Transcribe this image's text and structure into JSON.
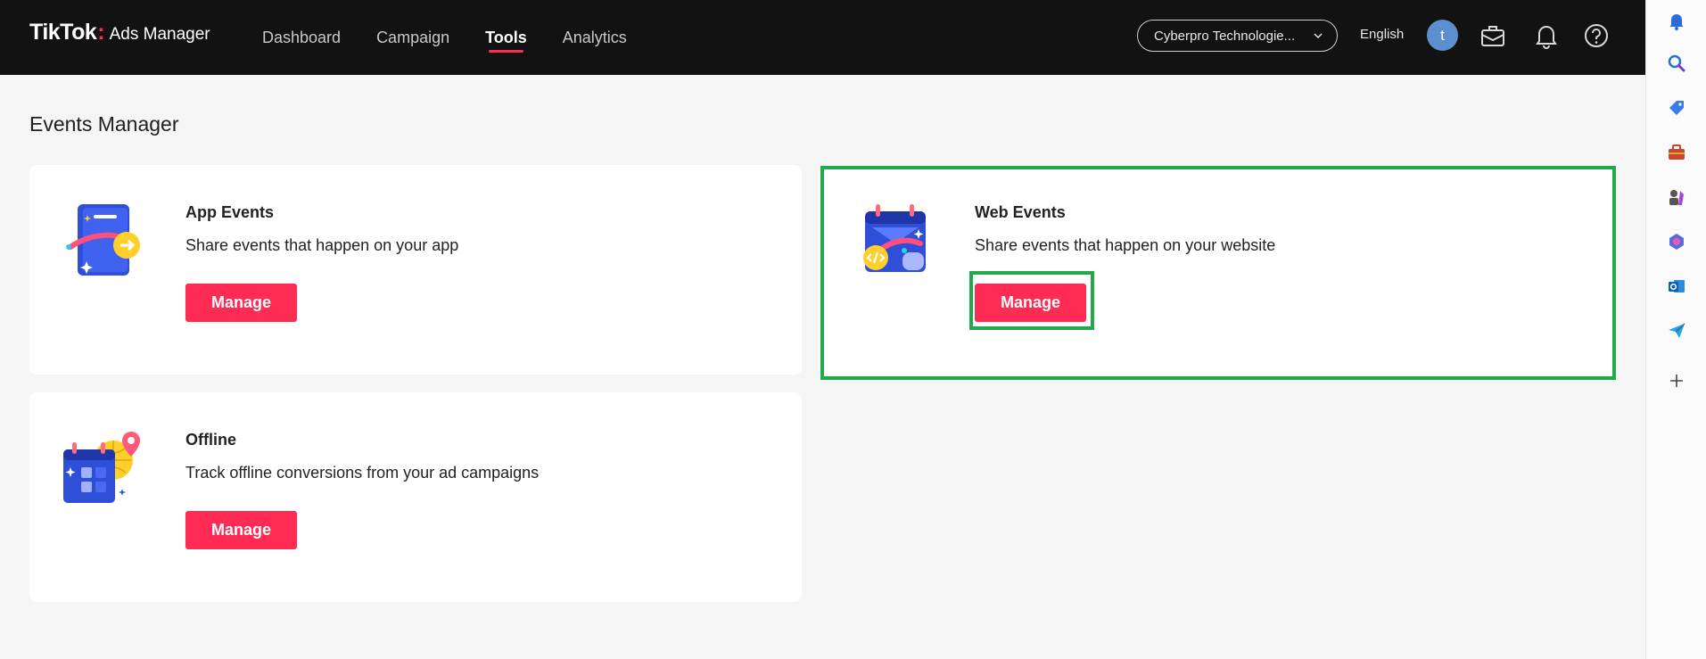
{
  "header": {
    "brand": "TikTok",
    "product": "Ads Manager",
    "nav": [
      {
        "label": "Dashboard",
        "active": false
      },
      {
        "label": "Campaign",
        "active": false
      },
      {
        "label": "Tools",
        "active": true
      },
      {
        "label": "Analytics",
        "active": false
      }
    ],
    "account": "Cyberpro Technologie...",
    "language": "English",
    "avatar_initial": "t",
    "icons": [
      "briefcase-icon",
      "bell-icon",
      "help-icon"
    ]
  },
  "page": {
    "title": "Events Manager"
  },
  "cards": [
    {
      "title": "App Events",
      "description": "Share events that happen on your app",
      "button": "Manage",
      "icon": "app-events-illustration"
    },
    {
      "title": "Web Events",
      "description": "Share events that happen on your website",
      "button": "Manage",
      "icon": "web-events-illustration"
    },
    {
      "title": "Offline",
      "description": "Track offline conversions from your ad campaigns",
      "button": "Manage",
      "icon": "offline-illustration"
    }
  ],
  "rail": {
    "icons": [
      "notification-bell-icon",
      "search-icon",
      "tag-icon",
      "toolbox-icon",
      "games-icon",
      "copilot-icon",
      "outlook-icon",
      "send-icon",
      "add-icon"
    ]
  },
  "colors": {
    "accent": "#fe2c55",
    "topbar": "#121212",
    "highlight": "#22a94a",
    "background": "#f5f5f5"
  }
}
